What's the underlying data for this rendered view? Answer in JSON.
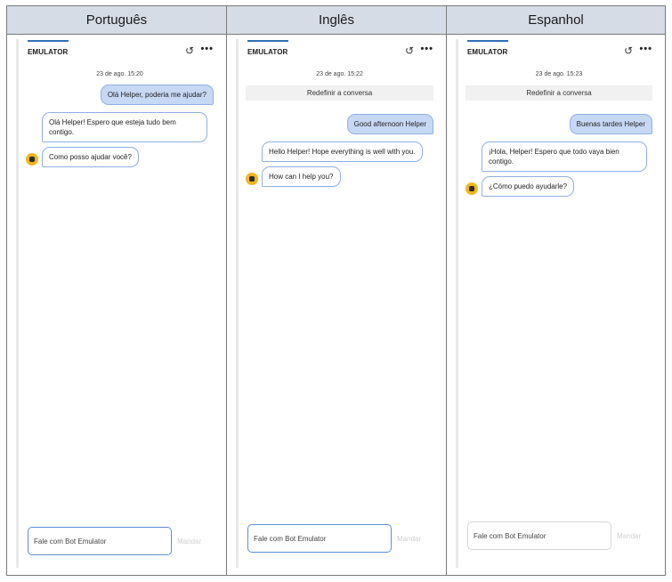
{
  "headers": [
    "Português",
    "Inglês",
    "Espanhol"
  ],
  "panels": [
    {
      "title": "EMULATOR",
      "timestamp": "23 de ago. 15:20",
      "reset_label": "",
      "user_message": "Olá Helper, poderia me ajudar?",
      "bot_messages": [
        "Olá Helper! Espero que esteja tudo bem contigo.",
        "Como posso ajudar você?"
      ],
      "input_placeholder": "Fale com Bot Emulator",
      "send_label": "Mandar"
    },
    {
      "title": "EMULATOR",
      "timestamp": "23 de ago. 15:22",
      "reset_label": "Redefinir a conversa",
      "user_message": "Good afternoon Helper",
      "bot_messages": [
        "Hello Helper! Hope everything is well with you.",
        "How can I help you?"
      ],
      "input_placeholder": "Fale com Bot Emulator",
      "send_label": "Mandar"
    },
    {
      "title": "EMULATOR",
      "timestamp": "23 de ago. 15:23",
      "reset_label": "Redefinir a conversa",
      "user_message": "Buenas tardes Helper",
      "bot_messages": [
        "¡Hola, Helper! Espero que todo vaya bien contigo.",
        "¿Cómo puedo ayudarle?"
      ],
      "input_placeholder": "Fale com Bot Emulator",
      "send_label": "Mandar"
    }
  ],
  "icons": {
    "restart": "restart-icon",
    "more": "more-options-icon",
    "avatar": "bot-avatar-icon"
  },
  "colors": {
    "header_bg": "#d6dce5",
    "user_bubble": "#c7d8f5",
    "bubble_border": "#8fb0e0",
    "accent": "#2f6fb5",
    "avatar": "#f2b61f"
  }
}
